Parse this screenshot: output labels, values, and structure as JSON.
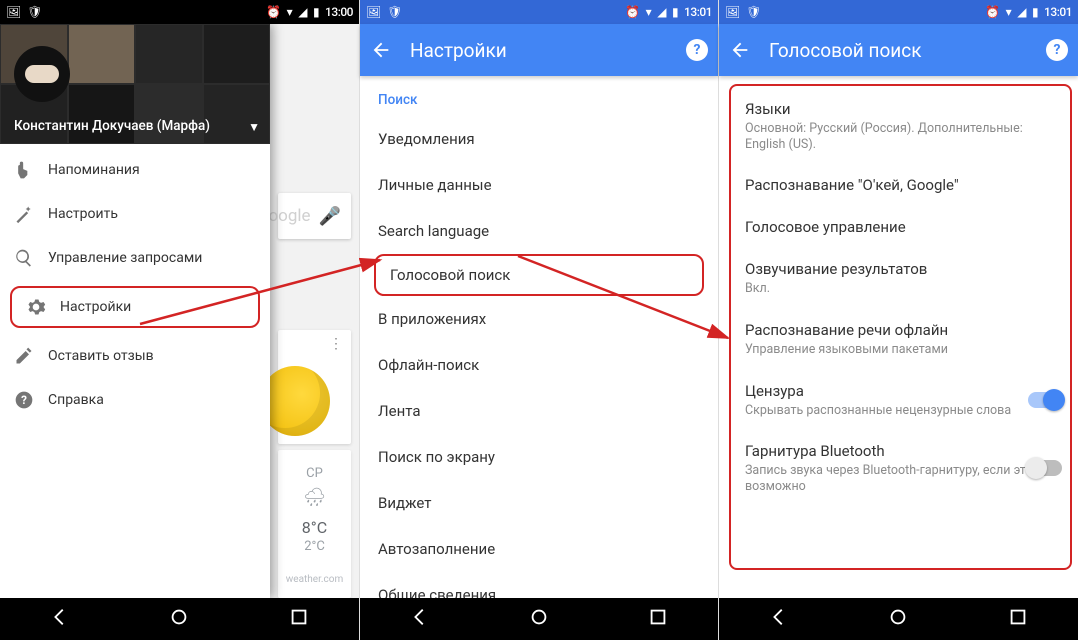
{
  "status": {
    "time": "13:00",
    "time_right": "13:01"
  },
  "panel1": {
    "user_name": "Константин Докучаев (Марфа)",
    "search_hint": "oogle",
    "weather": {
      "day": "СР",
      "t1": "8°C",
      "t2": "2°C",
      "src": "weather.com"
    },
    "items": [
      {
        "icon": "finger",
        "label": "Напоминания"
      },
      {
        "icon": "wand",
        "label": "Настроить"
      },
      {
        "icon": "search",
        "label": "Управление запросами"
      },
      {
        "icon": "gear",
        "label": "Настройки",
        "hl": true
      },
      {
        "icon": "pencil",
        "label": "Оставить отзыв"
      },
      {
        "icon": "help",
        "label": "Справка"
      }
    ]
  },
  "panel2": {
    "title": "Настройки",
    "section": "Поиск",
    "rows": [
      {
        "label": "Уведомления"
      },
      {
        "label": "Личные данные"
      },
      {
        "label": "Search language"
      },
      {
        "label": "Голосовой поиск",
        "hl": true
      },
      {
        "label": "В приложениях"
      },
      {
        "label": "Офлайн-поиск"
      },
      {
        "label": "Лента"
      },
      {
        "label": "Поиск по экрану"
      },
      {
        "label": "Виджет"
      },
      {
        "label": "Автозаполнение"
      },
      {
        "label": "Общие сведения"
      }
    ]
  },
  "panel3": {
    "title": "Голосовой поиск",
    "rows": [
      {
        "t": "Языки",
        "s": "Основной: Русский (Россия). Дополнительные: English (US)."
      },
      {
        "t": "Распознавание \"О'кей, Google\""
      },
      {
        "t": "Голосовое управление"
      },
      {
        "t": "Озвучивание результатов",
        "s": "Вкл."
      },
      {
        "t": "Распознавание речи офлайн",
        "s": "Управление языковыми пакетами"
      },
      {
        "t": "Цензура",
        "s": "Скрывать распознанные нецензурные слова",
        "toggle": "on"
      },
      {
        "t": "Гарнитура Bluetooth",
        "s": "Запись звука через Bluetooth-гарнитуру, если это возможно",
        "toggle": "off"
      }
    ]
  }
}
